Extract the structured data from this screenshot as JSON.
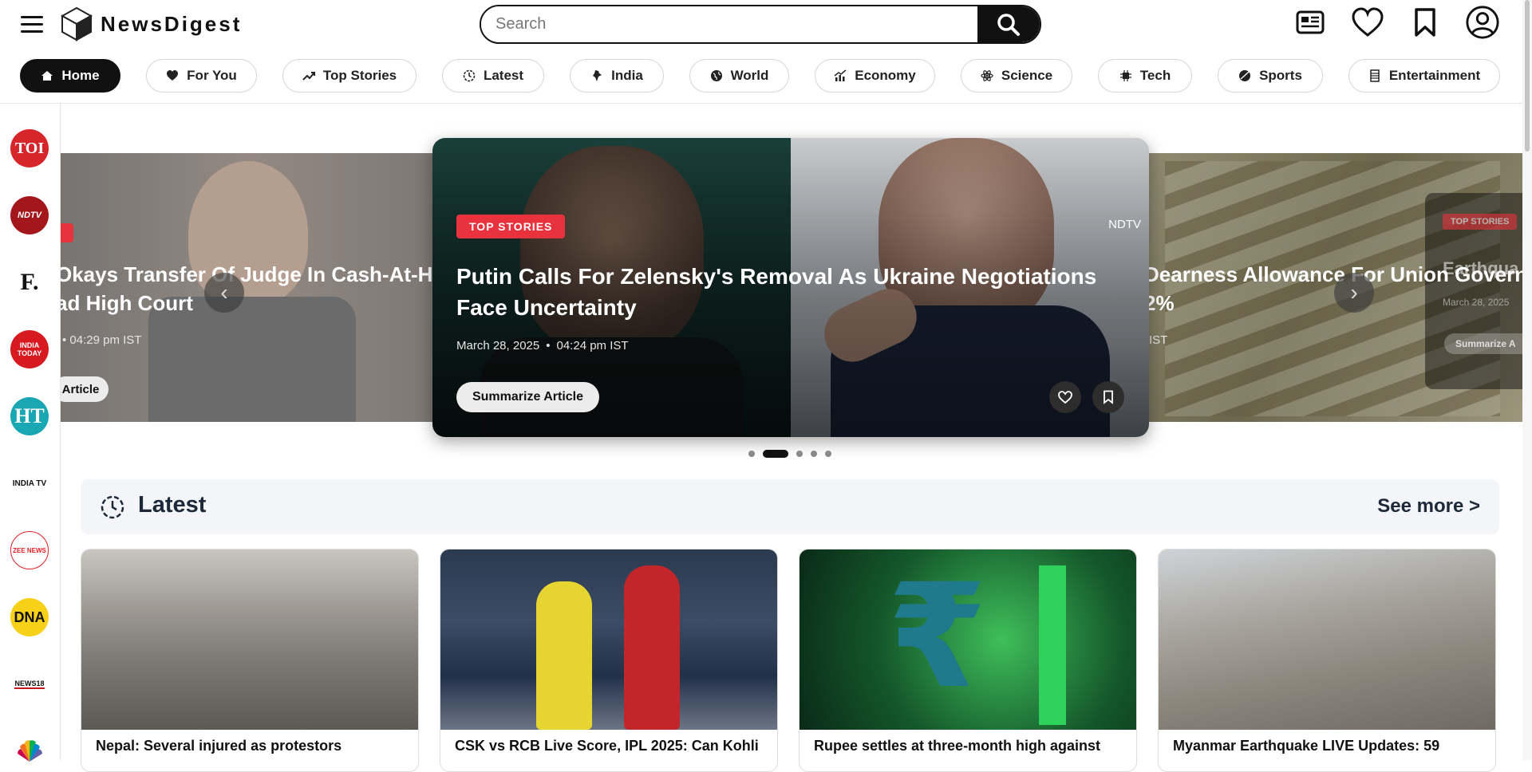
{
  "app": {
    "name": "NewsDigest"
  },
  "search": {
    "placeholder": "Search"
  },
  "categories": [
    {
      "label": "Home",
      "icon": "home-icon",
      "active": true
    },
    {
      "label": "For You",
      "icon": "heart-icon"
    },
    {
      "label": "Top Stories",
      "icon": "trending-icon"
    },
    {
      "label": "Latest",
      "icon": "clock-icon"
    },
    {
      "label": "India",
      "icon": "india-map-icon"
    },
    {
      "label": "World",
      "icon": "globe-icon"
    },
    {
      "label": "Economy",
      "icon": "chart-icon"
    },
    {
      "label": "Science",
      "icon": "atom-icon"
    },
    {
      "label": "Tech",
      "icon": "chip-icon"
    },
    {
      "label": "Sports",
      "icon": "ball-icon"
    },
    {
      "label": "Entertainment",
      "icon": "film-icon"
    }
  ],
  "sources": [
    {
      "label": "TOI",
      "color": "#d7262b"
    },
    {
      "label": "NDTV",
      "color": "#a3161c"
    },
    {
      "label": "F.",
      "color": "#111111"
    },
    {
      "label": "INDIA TODAY",
      "color": "#d71920"
    },
    {
      "label": "HT",
      "color": "#1aa7b4"
    },
    {
      "label": "INDIA TV",
      "color": "#111111"
    },
    {
      "label": "ZEE NEWS",
      "color": "#e31e24"
    },
    {
      "label": "DNA",
      "color": "#f7d117"
    },
    {
      "label": "NEWS18",
      "color": "#c4161c"
    }
  ],
  "carousel": {
    "prev_card": {
      "headline": "Okays Transfer Of Judge In Cash-At-Ho\nad High Court",
      "meta": "•  04:29 pm IST",
      "button": "Article"
    },
    "main_card": {
      "tag": "TOP STORIES",
      "source": "NDTV",
      "headline": "Putin Calls For Zelensky's Removal As Ukraine Negotiations Face Uncertainty",
      "date": "March 28, 2025",
      "time": "04:24 pm IST",
      "button": "Summarize Article"
    },
    "next_card": {
      "headline": "Dearness Allowance For Union Governm\n2%",
      "meta": "IST",
      "tag": "TOP STORIES",
      "headline2": "Earthqua",
      "date": "March 28, 2025",
      "button": "Summarize A"
    },
    "prev_arrow": "‹",
    "next_arrow": "›",
    "slides": 5,
    "active_slide": 2
  },
  "latest": {
    "title": "Latest",
    "see_more": "See more >",
    "cards": [
      {
        "title": "Nepal: Several injured as protestors"
      },
      {
        "title": "CSK vs RCB Live Score, IPL 2025: Can Kohli"
      },
      {
        "title": "Rupee settles at three-month high against"
      },
      {
        "title": "Myanmar Earthquake LIVE Updates: 59"
      }
    ]
  }
}
